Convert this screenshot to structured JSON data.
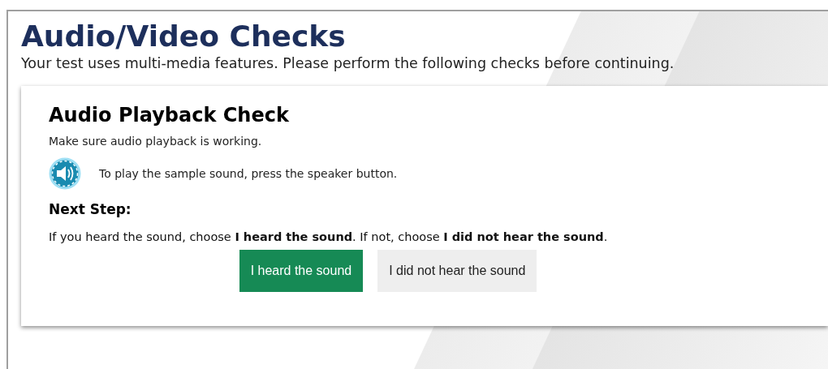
{
  "page": {
    "title": "Audio/Video Checks",
    "subtitle": "Your test uses multi-media features. Please perform the following checks before continuing."
  },
  "check": {
    "title": "Audio Playback Check",
    "description": "Make sure audio playback is working.",
    "instruction": "To play the sample sound, press the speaker button.",
    "next_step_heading": "Next Step:",
    "next_step_text": "If you heard the sound, choose **I heard the sound**. If not, choose **I did not hear the sound**.",
    "buttons": [
      {
        "label": "I heard the sound",
        "kind": "primary"
      },
      {
        "label": "I did not hear the sound",
        "kind": "secondary"
      }
    ]
  }
}
